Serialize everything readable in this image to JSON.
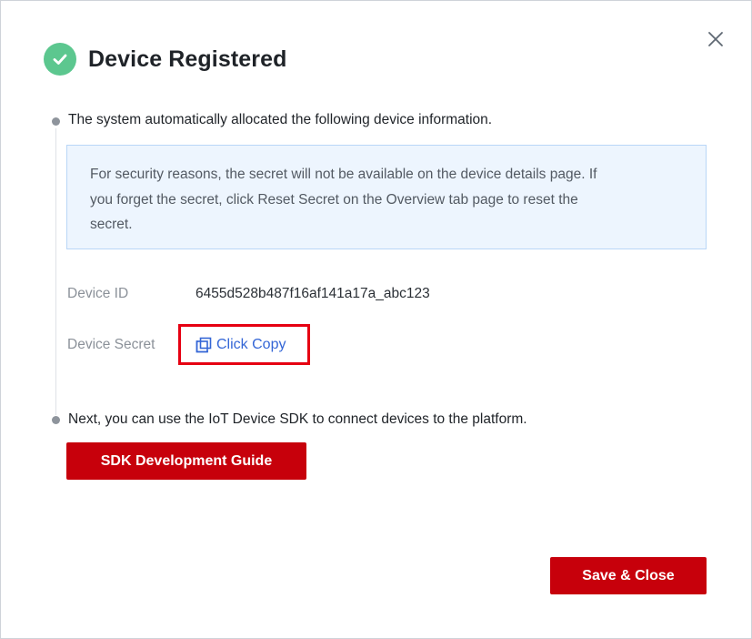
{
  "dialog": {
    "title": "Device Registered",
    "close_icon": "close-icon",
    "success_icon": "check-circle-icon",
    "accent_success": "#5cc78f",
    "accent_primary": "#c7000b"
  },
  "step1": {
    "text": "The system automatically allocated the following device information."
  },
  "notice": {
    "line1": "For security reasons, the secret will not be available on the device details page. If",
    "line2": "you forget the secret, click Reset Secret on the Overview tab page to reset the",
    "line3": "secret."
  },
  "device": {
    "id_label": "Device ID",
    "id_value": "6455d528b487f16af141a17a_abc123",
    "secret_label": "Device Secret",
    "copy_label": "Click Copy",
    "copy_icon": "copy-icon"
  },
  "step2": {
    "text": "Next, you can use the IoT Device SDK to connect devices to the platform.",
    "sdk_button": "SDK Development Guide"
  },
  "footer": {
    "save_close": "Save & Close"
  }
}
